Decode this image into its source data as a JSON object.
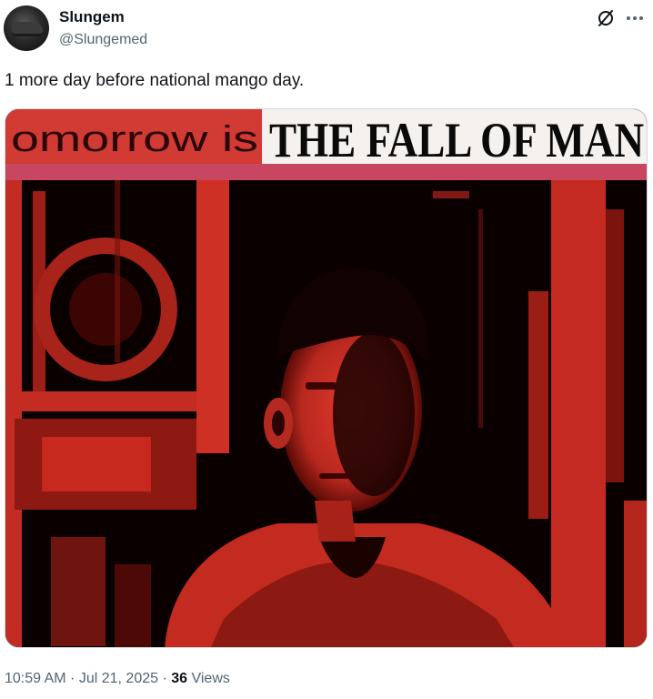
{
  "author": {
    "display_name": "Slungem",
    "handle": "@Slungemed"
  },
  "icons": {
    "avatar": "avatar-image",
    "grok": "grok-icon",
    "more": "more-options-icon"
  },
  "tweet": {
    "text": "1 more day before national mango day.",
    "media": {
      "caption_left": "omorrow is",
      "caption_right": "THE FALL OF MAN"
    }
  },
  "meta": {
    "time": "10:59 AM",
    "separator1": " · ",
    "date": "Jul 21, 2025",
    "separator2": " · ",
    "views_count": "36",
    "views_label": " Views"
  },
  "colors": {
    "text_primary": "#0f1419",
    "text_secondary": "#536471",
    "image_red": "#d8352a",
    "image_dark": "#0a0000"
  }
}
